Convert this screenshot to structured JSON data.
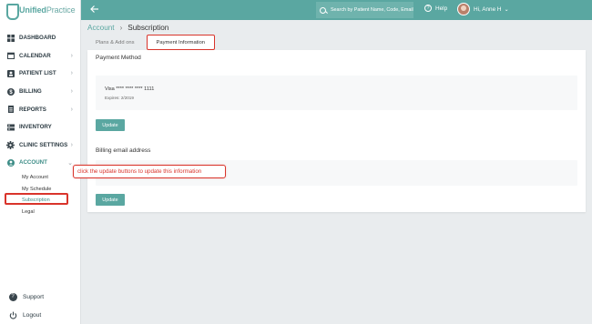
{
  "app": {
    "logo_bold": "Unified",
    "logo_thin": "Practice"
  },
  "sidebar": {
    "items": [
      {
        "label": "DASHBOARD",
        "icon": "dashboard-icon",
        "chevron": false
      },
      {
        "label": "CALENDAR",
        "icon": "calendar-icon",
        "chevron": true
      },
      {
        "label": "PATIENT LIST",
        "icon": "patient-list-icon",
        "chevron": true
      },
      {
        "label": "BILLING",
        "icon": "billing-dollar-icon",
        "chevron": true
      },
      {
        "label": "REPORTS",
        "icon": "reports-icon",
        "chevron": true
      },
      {
        "label": "INVENTORY",
        "icon": "inventory-icon",
        "chevron": false
      },
      {
        "label": "CLINIC SETTINGS",
        "icon": "gear-icon",
        "chevron": true
      },
      {
        "label": "ACCOUNT",
        "icon": "account-icon",
        "chevron": true
      }
    ],
    "account_sub": [
      {
        "label": "My Account"
      },
      {
        "label": "My Schedule"
      },
      {
        "label": "Subscription"
      },
      {
        "label": "Legal"
      }
    ],
    "footer": {
      "support": "Support",
      "logout": "Logout"
    }
  },
  "topbar": {
    "search_placeholder": "Search by Patient Name, Code, Email",
    "help_label": "Help",
    "user_greeting": "Hi, Anne H"
  },
  "breadcrumb": {
    "parent": "Account",
    "current": "Subscription"
  },
  "tabs": [
    {
      "label": "Plans & Add ons"
    },
    {
      "label": "Payment Information"
    }
  ],
  "payment": {
    "method_title": "Payment Method",
    "card_text": "Visa **** **** **** 1111",
    "expires": "Expires: 2/2019",
    "update_label": "Update"
  },
  "billing_email": {
    "title": "Billing email address",
    "update_label": "Update"
  },
  "annotation": {
    "text": "click the update buttons to update this information"
  },
  "colors": {
    "accent": "#5aa7a1",
    "highlight": "#d9342b"
  }
}
